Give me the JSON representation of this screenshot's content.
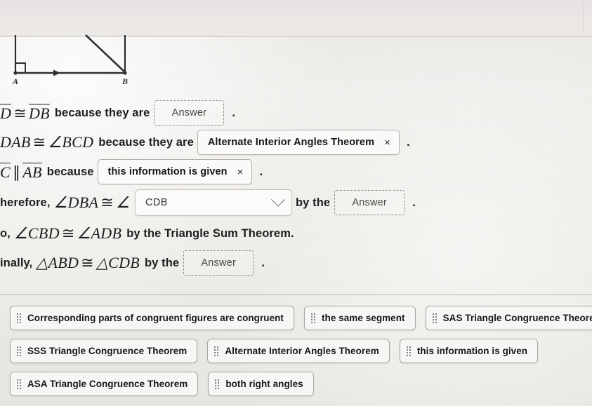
{
  "figure": {
    "label_a": "A",
    "label_b": "B",
    "right_angle_marker": "right-angle-square",
    "arrow_marker": "single-arrow"
  },
  "proof": {
    "lines": [
      {
        "id": "line-1",
        "pre_math": "D ≅ DB",
        "pre_text": "because they are",
        "field": {
          "type": "dropzone",
          "value": "Answer"
        },
        "post": "."
      },
      {
        "id": "line-2",
        "pre_math": "DAB ≅ ∠BCD",
        "pre_text": "because they are",
        "field": {
          "type": "chip",
          "value": "Alternate Interior Angles Theorem",
          "remove": "×"
        },
        "post": "."
      },
      {
        "id": "line-3",
        "pre_math": "C ∥ AB",
        "pre_text": "because",
        "field": {
          "type": "chip",
          "value": "this information is given",
          "remove": "×"
        },
        "post": "."
      },
      {
        "id": "line-4",
        "lead": "herefore,",
        "pre_math": "∠DBA ≅ ∠",
        "field": {
          "type": "select",
          "value": "CDB"
        },
        "mid_text": "by the",
        "field2": {
          "type": "dropzone",
          "value": "Answer"
        },
        "post": "."
      },
      {
        "id": "line-5",
        "lead": "o,",
        "pre_math": "∠CBD ≅ ∠ADB",
        "tail_text": "by the Triangle Sum Theorem."
      },
      {
        "id": "line-6",
        "lead": "inally,",
        "pre_math": "△ABD ≅ △CDB",
        "mid_text": "by the",
        "field2": {
          "type": "dropzone",
          "value": "Answer"
        },
        "post": "."
      }
    ]
  },
  "answer_bank": {
    "rows": [
      [
        {
          "label": "Corresponding parts of congruent figures are congruent"
        },
        {
          "label": "the same segment"
        },
        {
          "label": "SAS Triangle Congruence Theorem"
        }
      ],
      [
        {
          "label": "SSS Triangle Congruence Theorem"
        },
        {
          "label": "Alternate Interior Angles Theorem"
        },
        {
          "label": "this information is given"
        }
      ],
      [
        {
          "label": "ASA Triangle Congruence Theorem"
        },
        {
          "label": "both right angles"
        }
      ]
    ]
  },
  "colors": {
    "page_bg": "#eceae6",
    "ink": "#1d1d1f",
    "tile_bg": "#f7f6f4",
    "tile_border": "#a9a6a2",
    "dashed_border": "#8e8b87"
  }
}
